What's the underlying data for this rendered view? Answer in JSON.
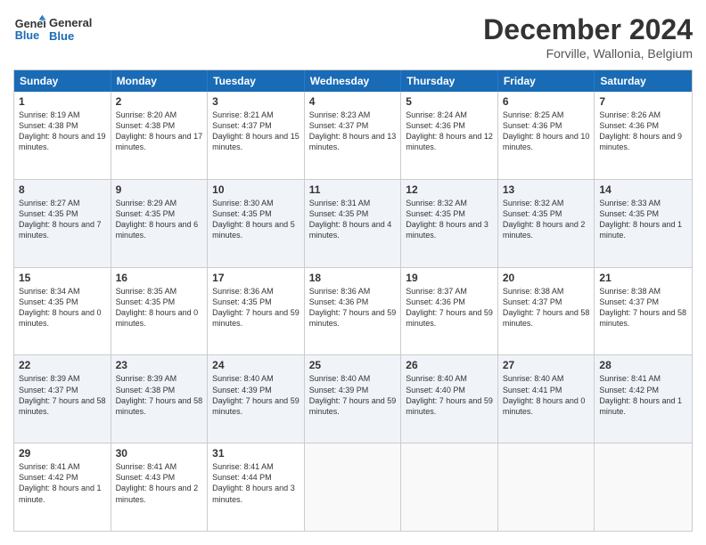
{
  "header": {
    "logo_line1": "General",
    "logo_line2": "Blue",
    "month_year": "December 2024",
    "location": "Forville, Wallonia, Belgium"
  },
  "days_of_week": [
    "Sunday",
    "Monday",
    "Tuesday",
    "Wednesday",
    "Thursday",
    "Friday",
    "Saturday"
  ],
  "weeks": [
    [
      {
        "day": 1,
        "sunrise": "8:19 AM",
        "sunset": "4:38 PM",
        "daylight": "8 hours and 19 minutes."
      },
      {
        "day": 2,
        "sunrise": "8:20 AM",
        "sunset": "4:38 PM",
        "daylight": "8 hours and 17 minutes."
      },
      {
        "day": 3,
        "sunrise": "8:21 AM",
        "sunset": "4:37 PM",
        "daylight": "8 hours and 15 minutes."
      },
      {
        "day": 4,
        "sunrise": "8:23 AM",
        "sunset": "4:37 PM",
        "daylight": "8 hours and 13 minutes."
      },
      {
        "day": 5,
        "sunrise": "8:24 AM",
        "sunset": "4:36 PM",
        "daylight": "8 hours and 12 minutes."
      },
      {
        "day": 6,
        "sunrise": "8:25 AM",
        "sunset": "4:36 PM",
        "daylight": "8 hours and 10 minutes."
      },
      {
        "day": 7,
        "sunrise": "8:26 AM",
        "sunset": "4:36 PM",
        "daylight": "8 hours and 9 minutes."
      }
    ],
    [
      {
        "day": 8,
        "sunrise": "8:27 AM",
        "sunset": "4:35 PM",
        "daylight": "8 hours and 7 minutes."
      },
      {
        "day": 9,
        "sunrise": "8:29 AM",
        "sunset": "4:35 PM",
        "daylight": "8 hours and 6 minutes."
      },
      {
        "day": 10,
        "sunrise": "8:30 AM",
        "sunset": "4:35 PM",
        "daylight": "8 hours and 5 minutes."
      },
      {
        "day": 11,
        "sunrise": "8:31 AM",
        "sunset": "4:35 PM",
        "daylight": "8 hours and 4 minutes."
      },
      {
        "day": 12,
        "sunrise": "8:32 AM",
        "sunset": "4:35 PM",
        "daylight": "8 hours and 3 minutes."
      },
      {
        "day": 13,
        "sunrise": "8:32 AM",
        "sunset": "4:35 PM",
        "daylight": "8 hours and 2 minutes."
      },
      {
        "day": 14,
        "sunrise": "8:33 AM",
        "sunset": "4:35 PM",
        "daylight": "8 hours and 1 minute."
      }
    ],
    [
      {
        "day": 15,
        "sunrise": "8:34 AM",
        "sunset": "4:35 PM",
        "daylight": "8 hours and 0 minutes."
      },
      {
        "day": 16,
        "sunrise": "8:35 AM",
        "sunset": "4:35 PM",
        "daylight": "8 hours and 0 minutes."
      },
      {
        "day": 17,
        "sunrise": "8:36 AM",
        "sunset": "4:35 PM",
        "daylight": "7 hours and 59 minutes."
      },
      {
        "day": 18,
        "sunrise": "8:36 AM",
        "sunset": "4:36 PM",
        "daylight": "7 hours and 59 minutes."
      },
      {
        "day": 19,
        "sunrise": "8:37 AM",
        "sunset": "4:36 PM",
        "daylight": "7 hours and 59 minutes."
      },
      {
        "day": 20,
        "sunrise": "8:38 AM",
        "sunset": "4:37 PM",
        "daylight": "7 hours and 58 minutes."
      },
      {
        "day": 21,
        "sunrise": "8:38 AM",
        "sunset": "4:37 PM",
        "daylight": "7 hours and 58 minutes."
      }
    ],
    [
      {
        "day": 22,
        "sunrise": "8:39 AM",
        "sunset": "4:37 PM",
        "daylight": "7 hours and 58 minutes."
      },
      {
        "day": 23,
        "sunrise": "8:39 AM",
        "sunset": "4:38 PM",
        "daylight": "7 hours and 58 minutes."
      },
      {
        "day": 24,
        "sunrise": "8:40 AM",
        "sunset": "4:39 PM",
        "daylight": "7 hours and 59 minutes."
      },
      {
        "day": 25,
        "sunrise": "8:40 AM",
        "sunset": "4:39 PM",
        "daylight": "7 hours and 59 minutes."
      },
      {
        "day": 26,
        "sunrise": "8:40 AM",
        "sunset": "4:40 PM",
        "daylight": "7 hours and 59 minutes."
      },
      {
        "day": 27,
        "sunrise": "8:40 AM",
        "sunset": "4:41 PM",
        "daylight": "8 hours and 0 minutes."
      },
      {
        "day": 28,
        "sunrise": "8:41 AM",
        "sunset": "4:42 PM",
        "daylight": "8 hours and 1 minute."
      }
    ],
    [
      {
        "day": 29,
        "sunrise": "8:41 AM",
        "sunset": "4:42 PM",
        "daylight": "8 hours and 1 minute."
      },
      {
        "day": 30,
        "sunrise": "8:41 AM",
        "sunset": "4:43 PM",
        "daylight": "8 hours and 2 minutes."
      },
      {
        "day": 31,
        "sunrise": "8:41 AM",
        "sunset": "4:44 PM",
        "daylight": "8 hours and 3 minutes."
      },
      null,
      null,
      null,
      null
    ]
  ]
}
